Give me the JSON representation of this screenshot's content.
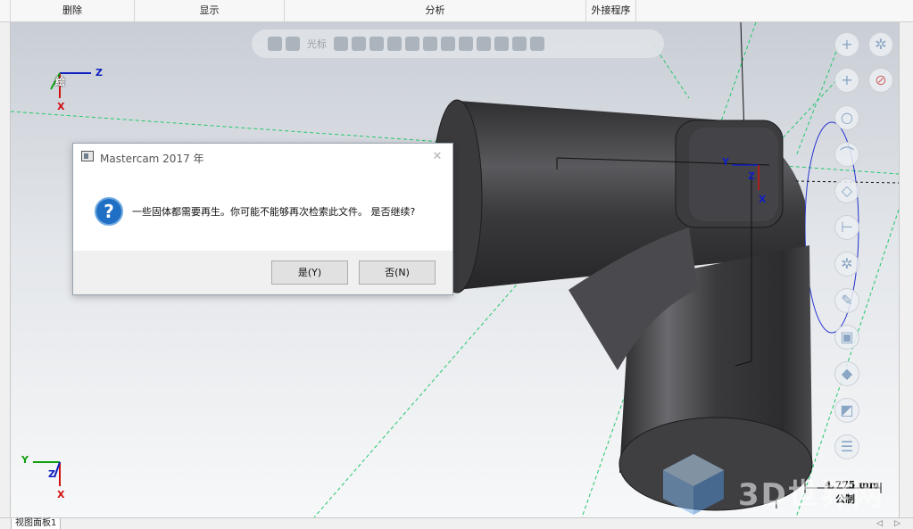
{
  "ribbon": {
    "groups": [
      {
        "label": "删除"
      },
      {
        "label": "显示"
      },
      {
        "label": "分析"
      },
      {
        "label": "外接程序"
      }
    ]
  },
  "toolbar": {
    "cursor_label": "光标"
  },
  "axes": {
    "top_indicator": {
      "z": "Z",
      "x": "X",
      "plane": "绘"
    },
    "center_indicator": {
      "y": "Y",
      "z": "Z",
      "x": "X"
    },
    "bottom_indicator": {
      "y": "Y",
      "z": "Z",
      "x": "X"
    }
  },
  "dialog": {
    "title": "Mastercam 2017 年",
    "close": "✕",
    "icon": "?",
    "message": "一些固体都需要再生。你可能不能够再次检索此文件。 是否继续?",
    "yes_label": "是(Y)",
    "no_label": "否(N)"
  },
  "scale_bar": {
    "value": "4.775 mm",
    "unit": "公制"
  },
  "watermark": {
    "text": "3D世界网"
  },
  "bottom_bar": {
    "tab_label": "视图面板1",
    "left_arrow": "◁",
    "right_arrow": "▷"
  },
  "colors": {
    "accent_blue": "#1f6fc4",
    "axis_red": "#d01010",
    "axis_blue": "#1020c0",
    "axis_green": "#10a010",
    "guide_green": "#22c76b",
    "solid_dark": "#3b3b3e"
  }
}
